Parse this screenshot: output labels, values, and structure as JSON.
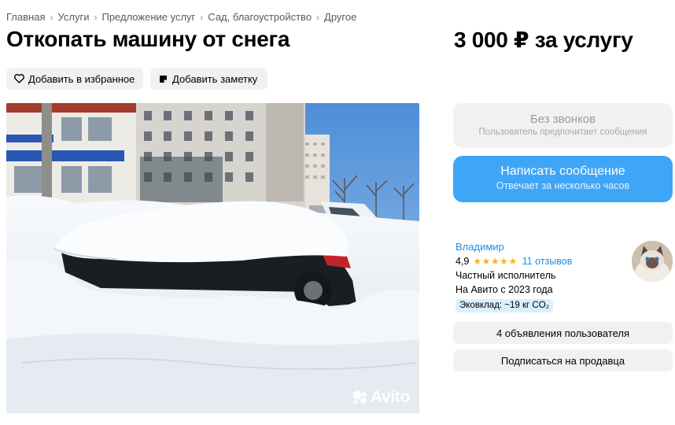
{
  "breadcrumb": {
    "items": [
      "Главная",
      "Услуги",
      "Предложение услуг",
      "Сад, благоустройство",
      "Другое"
    ],
    "separator": "›"
  },
  "listing": {
    "title": "Откопать машину от снега",
    "price": "3 000 ₽ за услугу"
  },
  "actions": {
    "favorite_label": "Добавить в избранное",
    "note_label": "Добавить заметку"
  },
  "photo": {
    "watermark": "Avito"
  },
  "contact": {
    "no_calls_title": "Без звонков",
    "no_calls_subtitle": "Пользователь предпочитает сообщения",
    "message_title": "Написать сообщение",
    "message_subtitle": "Отвечает за несколько часов"
  },
  "seller": {
    "name": "Владимир",
    "rating": "4,9",
    "stars": "★★★★★",
    "reviews": "11 отзывов",
    "type": "Частный исполнитель",
    "since": "На Авито с 2023 года",
    "eco": "Эковклад: ~19 кг CO₂",
    "listings_button": "4 объявления пользователя",
    "subscribe_button": "Подписаться на продавца"
  },
  "colors": {
    "accent_blue": "#3fa6f7",
    "link_blue": "#1c8ee8",
    "star_orange": "#ffb021",
    "pill_bg": "#f2f1f0",
    "eco_bg": "#d9f0ff"
  },
  "icons": {
    "favorite": "heart-icon",
    "note": "note-icon",
    "watermark": "avito-logo-icon"
  }
}
